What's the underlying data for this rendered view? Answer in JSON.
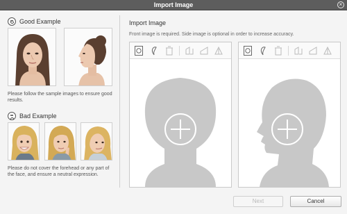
{
  "window": {
    "title": "Import Image",
    "close_glyph": "×"
  },
  "good": {
    "heading": "Good Example",
    "icon": "smiley-happy-icon",
    "note": "Please follow the sample images to ensure good results."
  },
  "bad": {
    "heading": "Bad Example",
    "icon": "smiley-sad-icon",
    "note": "Please do not cover the forehead or any part of the face, and ensure a neutral expression."
  },
  "import": {
    "title": "Import Image",
    "requirement": "Front image is required. Side image is optional in order to increase accuracy."
  },
  "panels": {
    "front": {
      "toolbar": [
        "import-image-icon",
        "crop-icon",
        "delete-icon",
        "flip-icon",
        "rotate-icon",
        "levels-icon"
      ]
    },
    "side": {
      "toolbar": [
        "import-image-icon",
        "crop-icon",
        "delete-icon",
        "flip-icon",
        "rotate-icon",
        "levels-icon"
      ]
    }
  },
  "buttons": {
    "next": "Next",
    "cancel": "Cancel"
  },
  "colors": {
    "titlebar": "#5d5d5d",
    "silhouette": "#c8c8c8",
    "background": "#f4f4f4"
  }
}
